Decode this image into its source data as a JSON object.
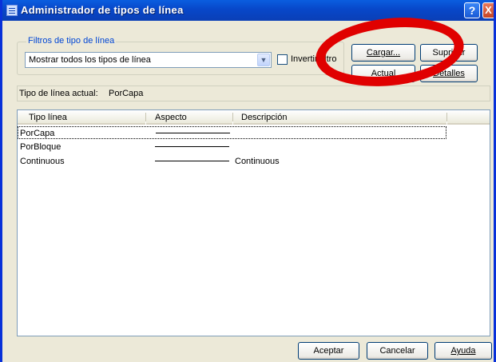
{
  "window": {
    "title": "Administrador de tipos de línea",
    "help_label": "?",
    "close_label": "X"
  },
  "filters": {
    "group_label": "Filtros de tipo de línea",
    "selected": "Mostrar todos los tipos de línea",
    "invert_label": "Invertir filtro",
    "invert_checked": false
  },
  "buttons": {
    "load": "Cargar...",
    "delete": "Suprimir",
    "current": "Actual",
    "details": "Detalles",
    "accept": "Aceptar",
    "cancel": "Cancelar",
    "help": "Ayuda"
  },
  "current_linetype": {
    "label": "Tipo de línea actual:",
    "value": "PorCapa"
  },
  "table": {
    "columns": [
      "Tipo línea",
      "Aspecto",
      "Descripción"
    ],
    "rows": [
      {
        "name": "PorCapa",
        "description": ""
      },
      {
        "name": "PorBloque",
        "description": ""
      },
      {
        "name": "Continuous",
        "description": "Continuous"
      }
    ]
  },
  "annotation": {
    "shape": "red-ellipse",
    "color": "#e00000"
  }
}
